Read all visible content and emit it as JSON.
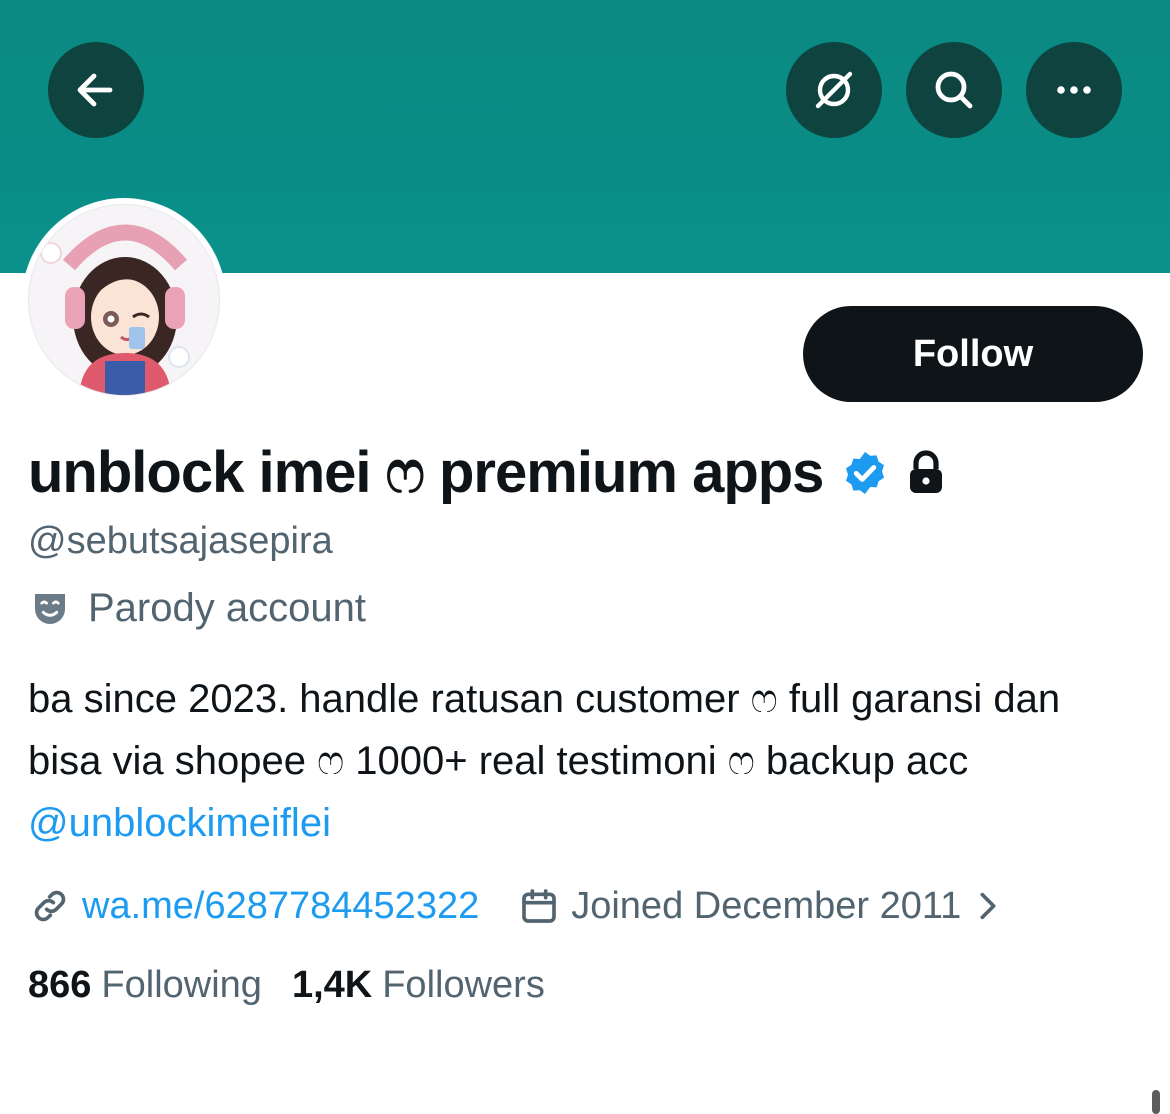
{
  "header": {
    "back_icon": "arrow-left-icon",
    "translate_icon": "translate-off-icon",
    "search_icon": "search-icon",
    "more_icon": "more-horizontal-icon",
    "banner_color": "#0a8a82"
  },
  "profile": {
    "display_name": "unblock imei ෆ premium apps",
    "verified_badge": "verified-badge-icon",
    "protected_icon": "lock-icon",
    "handle": "@sebutsajasepira",
    "parody_label": "Parody account",
    "bio_text": "ba since 2023. handle ratusan customer ෆ full garansi dan bisa via shopee ෆ 1000+ real testimoni ෆ backup acc ",
    "bio_mention": "@unblockimeiflei",
    "link_text": "wa.me/6287784452322",
    "joined_text": "Joined December 2011",
    "following_count": "866",
    "following_label": "Following",
    "followers_count": "1,4K",
    "followers_label": "Followers"
  },
  "actions": {
    "follow_label": "Follow"
  },
  "colors": {
    "accent": "#1d9bf0",
    "text_primary": "#0f1419",
    "text_secondary": "#536471",
    "button_dark": "#0f1419"
  }
}
